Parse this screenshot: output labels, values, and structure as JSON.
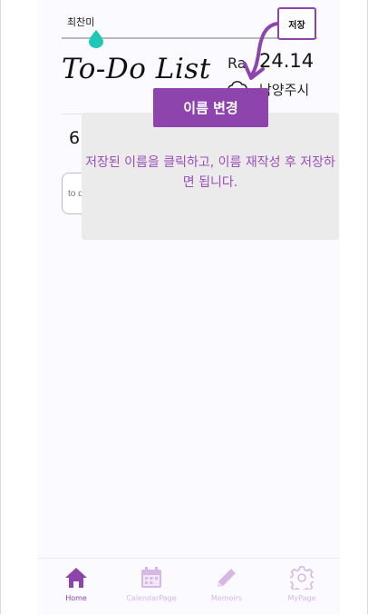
{
  "header": {
    "user_name": "최찬미",
    "save_label": "저장",
    "title": "To-Do List",
    "date_label": "Ra",
    "date_value": "24.14",
    "location": "남양주시"
  },
  "todo": {
    "count": "6",
    "input_placeholder": "to d"
  },
  "tooltip": {
    "badge": "이름 변경",
    "message": "저장된 이름을 클릭하고, 이름 재작성 후 저장하면 됩니다."
  },
  "nav": {
    "items": [
      {
        "label": "Home",
        "icon": "home-icon",
        "active": true
      },
      {
        "label": "CalendarPage",
        "icon": "calendar-icon",
        "active": false
      },
      {
        "label": "Memoirs",
        "icon": "pencil-icon",
        "active": false
      },
      {
        "label": "MyPage",
        "icon": "gear-icon",
        "active": false
      }
    ]
  },
  "colors": {
    "accent": "#8e44ad",
    "accent_light": "#d6b8e6",
    "thumb": "#1ec7b6",
    "tooltip_bg": "#ebebeb",
    "tooltip_text": "#9b4fb8"
  }
}
